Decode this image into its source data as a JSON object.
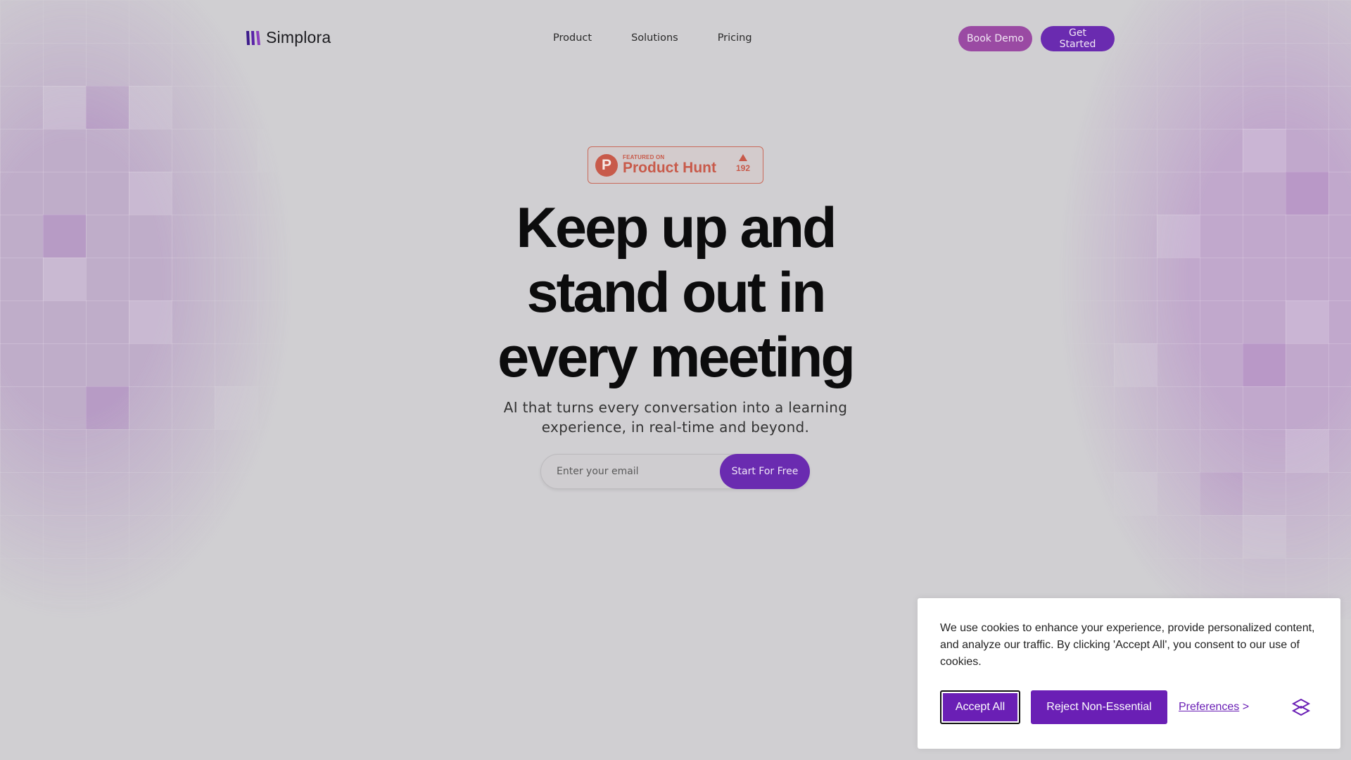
{
  "brand": {
    "name": "Simplora",
    "accent": "#6a2bb0",
    "accent_alt": "#9a4aa3"
  },
  "nav": {
    "items": [
      {
        "label": "Product"
      },
      {
        "label": "Solutions"
      },
      {
        "label": "Pricing"
      }
    ],
    "book_demo_label": "Book Demo",
    "get_started_label": "Get Started"
  },
  "badge": {
    "small_text": "FEATURED ON",
    "big_text": "Product Hunt",
    "logo_letter": "P",
    "upvotes": "192",
    "color": "#c85a4a"
  },
  "hero": {
    "title_lines": [
      "Keep up and",
      "stand out in",
      "every meeting"
    ],
    "subtitle": "AI that turns every conversation into a learning experience, in real-time and beyond.",
    "email_placeholder": "Enter your email",
    "cta_label": "Start For Free"
  },
  "cookie": {
    "message": "We use cookies to enhance your experience, provide personalized content, and analyze our traffic. By clicking 'Accept All', you consent to our use of cookies.",
    "accept_label": "Accept All",
    "reject_label": "Reject Non-Essential",
    "preferences_label": "Preferences",
    "preferences_arrow": ">",
    "button_color": "#6a1fb5"
  }
}
